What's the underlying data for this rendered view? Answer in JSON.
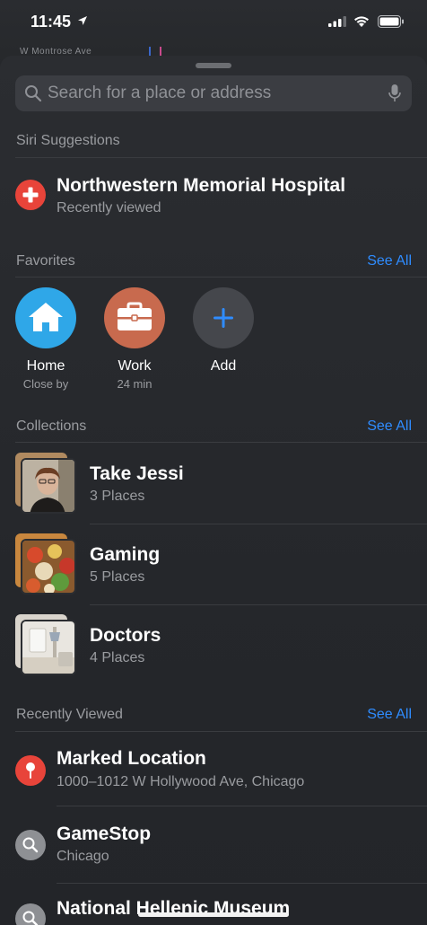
{
  "status_bar": {
    "time": "11:45"
  },
  "map": {
    "road_label": "W Montrose Ave"
  },
  "search": {
    "placeholder": "Search for a place or address"
  },
  "siri": {
    "header": "Siri Suggestions",
    "item": {
      "title": "Northwestern Memorial Hospital",
      "subtitle": "Recently viewed",
      "icon": "hospital-plus-icon"
    }
  },
  "favorites": {
    "header": "Favorites",
    "see_all": "See All",
    "items": [
      {
        "label": "Home",
        "sub": "Close by",
        "icon": "house-icon",
        "color": "#2fa7e8"
      },
      {
        "label": "Work",
        "sub": "24 min",
        "icon": "briefcase-icon",
        "color": "#c86a4e"
      },
      {
        "label": "Add",
        "sub": "",
        "icon": "plus-icon",
        "color": "#45474c"
      }
    ]
  },
  "collections": {
    "header": "Collections",
    "see_all": "See All",
    "items": [
      {
        "title": "Take Jessi",
        "sub": "3 Places"
      },
      {
        "title": "Gaming",
        "sub": "5 Places"
      },
      {
        "title": "Doctors",
        "sub": "4 Places"
      }
    ]
  },
  "recent": {
    "header": "Recently Viewed",
    "see_all": "See All",
    "items": [
      {
        "title": "Marked Location",
        "sub": "1000–1012 W Hollywood Ave, Chicago",
        "icon": "pin-icon"
      },
      {
        "title": "GameStop",
        "sub": "Chicago",
        "icon": "search-icon"
      },
      {
        "title": "National Hellenic Museum",
        "sub": "",
        "icon": "search-icon"
      }
    ]
  },
  "colors": {
    "accent": "#2f8cff",
    "red": "#e8443a",
    "gray_badge": "#8e9094"
  }
}
